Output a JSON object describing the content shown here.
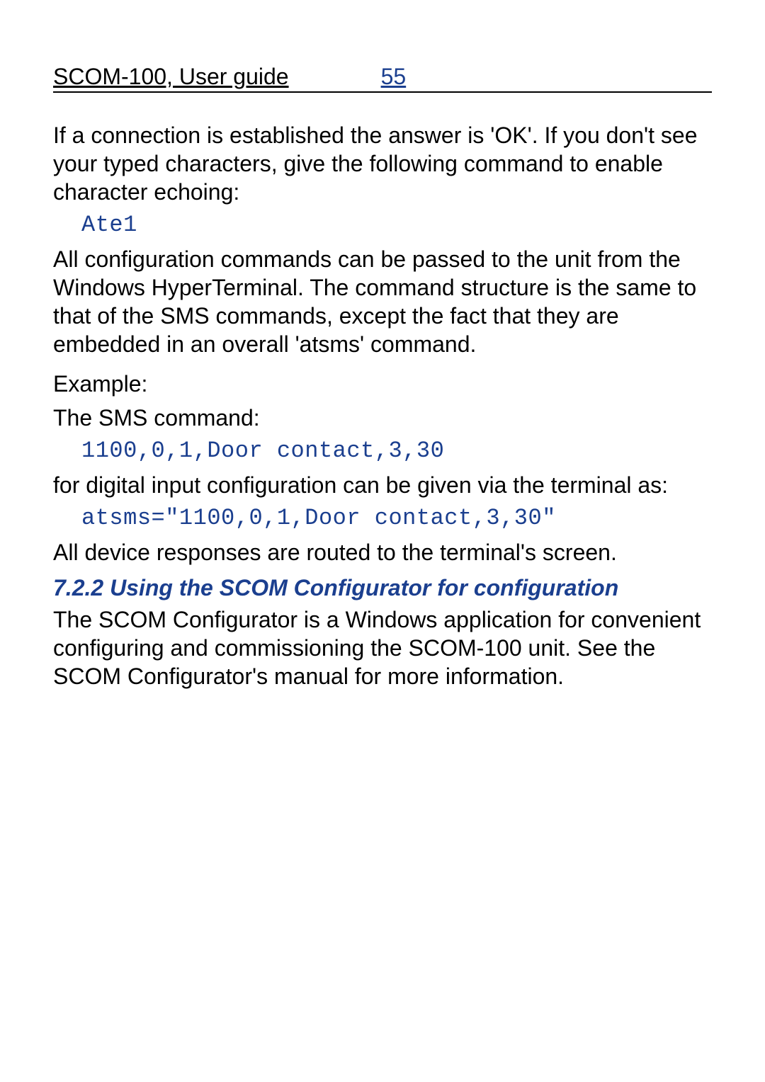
{
  "header": {
    "title": "SCOM-100, User guide",
    "page": "55"
  },
  "p1": "If a connection is established the answer is 'OK'. If you don't see your typed characters, give the following command to enable character echoing:",
  "code1": "Ate1",
  "p2": "All configuration commands can be passed to the unit from the Windows HyperTerminal. The command structure is the same to that of the SMS commands, except the fact that they are embedded in an overall 'atsms' command.",
  "p3": "Example:",
  "p4": "The SMS command:",
  "code2": "1100,0,1,Door contact,3,30",
  "p5": "for digital input configuration can be given via the terminal as:",
  "code3": "atsms=\"1100,0,1,Door contact,3,30\"",
  "p6": "All device responses are routed to the terminal's screen.",
  "heading": "7.2.2 Using the SCOM Configurator for configuration",
  "p7": "The SCOM Configurator is a Windows application for convenient configuring and commissioning the SCOM-100 unit. See the SCOM Configurator's manual for more information."
}
